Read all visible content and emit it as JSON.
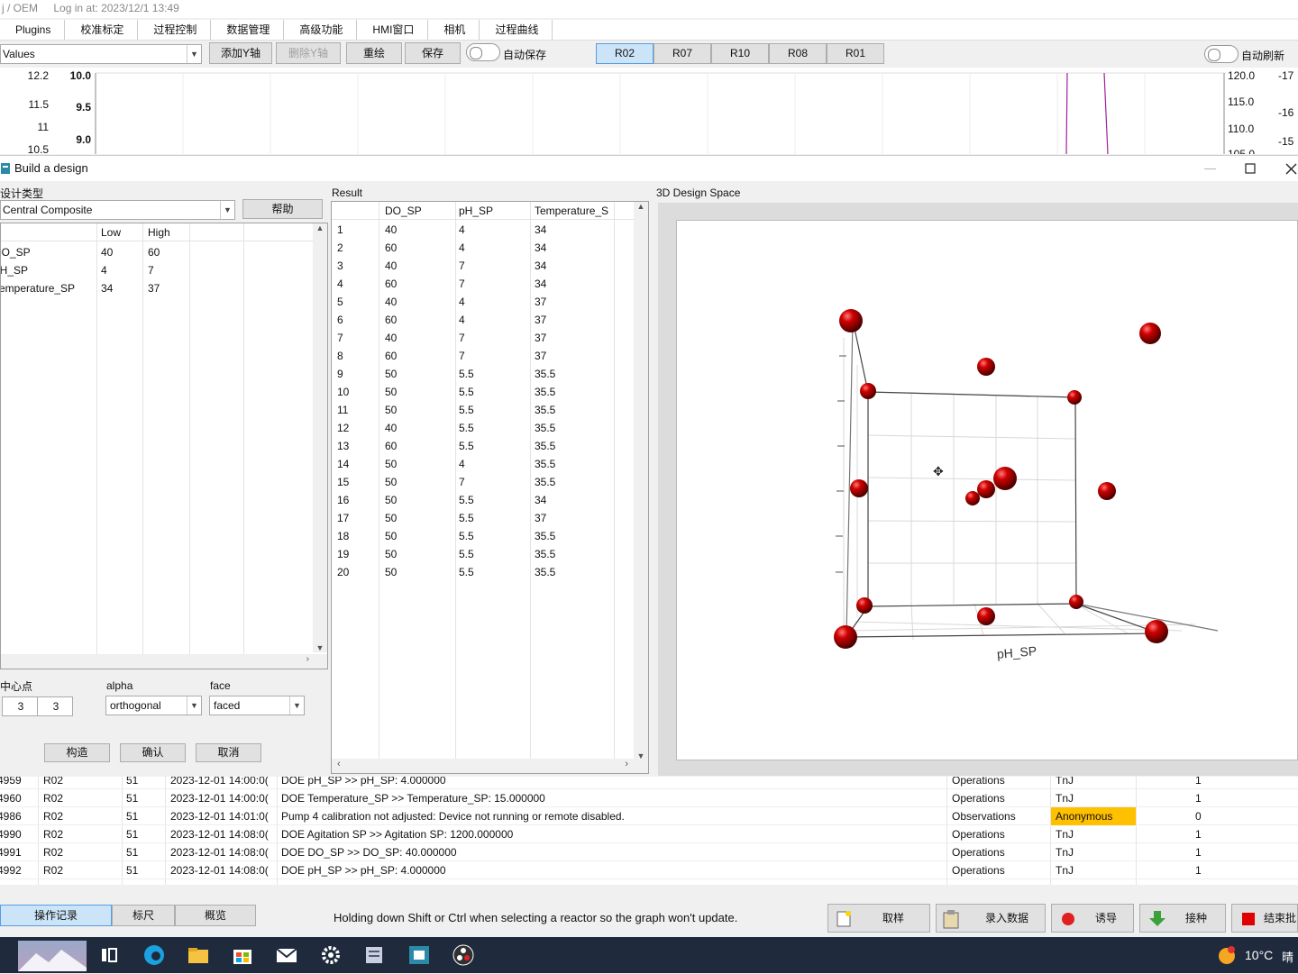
{
  "titlebar": {
    "user": "j / OEM",
    "login": "Log in at: 2023/12/1 13:49"
  },
  "menu": [
    "Plugins",
    "校准标定",
    "过程控制",
    "数据管理",
    "高级功能",
    "HMI窗口",
    "相机",
    "过程曲线"
  ],
  "toolbar": {
    "values_combo": "Values",
    "add_y": "添加Y轴",
    "remove_y": "删除Y轴",
    "redraw": "重绘",
    "save": "保存",
    "autosave": "自动保存",
    "autorefresh": "自动刷新",
    "reactors": [
      "R02",
      "R07",
      "R10",
      "R08",
      "R01"
    ]
  },
  "chart_strip": {
    "left_ticks_outer": [
      "12.2",
      "11.5",
      "11",
      "10.5"
    ],
    "left_ticks_inner": [
      "10.0",
      "9.5",
      "9.0"
    ],
    "right_ticks_inner": [
      "120.0",
      "115.0",
      "110.0",
      "105.0"
    ],
    "right_ticks_outer": [
      "-17",
      "-16",
      "-15"
    ]
  },
  "dialog": {
    "title": "Build a design",
    "design_type_label": "设计类型",
    "design_type_value": "Central Composite",
    "help_button": "帮助",
    "factor_headers": [
      "",
      "Low",
      "High"
    ],
    "factors": [
      {
        "name": "DO_SP",
        "low": "40",
        "high": "60"
      },
      {
        "name": "pH_SP",
        "low": "4",
        "high": "7"
      },
      {
        "name": "Temperature_SP",
        "low": "34",
        "high": "37"
      }
    ],
    "center_label": "中心点",
    "center_values": [
      "3",
      "3"
    ],
    "alpha_label": "alpha",
    "alpha_value": "orthogonal",
    "face_label": "face",
    "face_value": "faced",
    "build_button": "构造",
    "ok_button": "确认",
    "cancel_button": "取消",
    "result_label": "Result",
    "result_headers": [
      "",
      "DO_SP",
      "pH_SP",
      "Temperature_S"
    ],
    "results": [
      [
        "1",
        "40",
        "4",
        "34"
      ],
      [
        "2",
        "60",
        "4",
        "34"
      ],
      [
        "3",
        "40",
        "7",
        "34"
      ],
      [
        "4",
        "60",
        "7",
        "34"
      ],
      [
        "5",
        "40",
        "4",
        "37"
      ],
      [
        "6",
        "60",
        "4",
        "37"
      ],
      [
        "7",
        "40",
        "7",
        "37"
      ],
      [
        "8",
        "60",
        "7",
        "37"
      ],
      [
        "9",
        "50",
        "5.5",
        "35.5"
      ],
      [
        "10",
        "50",
        "5.5",
        "35.5"
      ],
      [
        "11",
        "50",
        "5.5",
        "35.5"
      ],
      [
        "12",
        "40",
        "5.5",
        "35.5"
      ],
      [
        "13",
        "60",
        "5.5",
        "35.5"
      ],
      [
        "14",
        "50",
        "4",
        "35.5"
      ],
      [
        "15",
        "50",
        "7",
        "35.5"
      ],
      [
        "16",
        "50",
        "5.5",
        "34"
      ],
      [
        "17",
        "50",
        "5.5",
        "37"
      ],
      [
        "18",
        "50",
        "5.5",
        "35.5"
      ],
      [
        "19",
        "50",
        "5.5",
        "35.5"
      ],
      [
        "20",
        "50",
        "5.5",
        "35.5"
      ]
    ],
    "space_label": "3D Design Space",
    "axis_label_ph": "pH_SP"
  },
  "log": [
    {
      "id": "4959",
      "reactor": "R02",
      "n": "51",
      "time": "2023-12-01 14:00:0(",
      "msg": "DOE pH_SP >> pH_SP: 4.000000",
      "cat": "Operations",
      "user": "TnJ",
      "flag": "1"
    },
    {
      "id": "4960",
      "reactor": "R02",
      "n": "51",
      "time": "2023-12-01 14:00:0(",
      "msg": "DOE Temperature_SP >> Temperature_SP: 15.000000",
      "cat": "Operations",
      "user": "TnJ",
      "flag": "1"
    },
    {
      "id": "4986",
      "reactor": "R02",
      "n": "51",
      "time": "2023-12-01 14:01:0(",
      "msg": "Pump 4 calibration not adjusted: Device not running or remote disabled.",
      "cat": "Observations",
      "user": "Anonymous",
      "flag": "0"
    },
    {
      "id": "4990",
      "reactor": "R02",
      "n": "51",
      "time": "2023-12-01 14:08:0(",
      "msg": "DOE Agitation SP >> Agitation SP: 1200.000000",
      "cat": "Operations",
      "user": "TnJ",
      "flag": "1"
    },
    {
      "id": "4991",
      "reactor": "R02",
      "n": "51",
      "time": "2023-12-01 14:08:0(",
      "msg": "DOE DO_SP >> DO_SP: 40.000000",
      "cat": "Operations",
      "user": "TnJ",
      "flag": "1"
    },
    {
      "id": "4992",
      "reactor": "R02",
      "n": "51",
      "time": "2023-12-01 14:08:0(",
      "msg": "DOE pH_SP >> pH_SP: 4.000000",
      "cat": "Operations",
      "user": "TnJ",
      "flag": "1"
    }
  ],
  "bottom": {
    "tabs": [
      "操作记录",
      "标尺",
      "概览"
    ],
    "hint": "Holding down Shift or Ctrl when selecting a reactor so the graph won't update.",
    "actions": [
      "取样",
      "录入数据",
      "诱导",
      "接种",
      "结束批"
    ]
  },
  "taskbar": {
    "weather": "10°C",
    "weather_extra": "晴"
  },
  "colors": {
    "accent": "#cce4f7",
    "sphere": "#b00000",
    "badge": "#ffc000"
  }
}
